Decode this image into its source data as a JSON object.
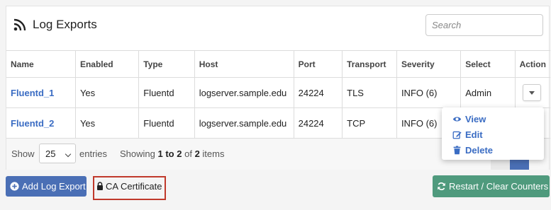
{
  "panel": {
    "title": "Log Exports",
    "search_placeholder": "Search"
  },
  "table": {
    "headers": [
      "Name",
      "Enabled",
      "Type",
      "Host",
      "Port",
      "Transport",
      "Severity",
      "Select",
      "Action"
    ],
    "rows": [
      {
        "name": "Fluentd_1",
        "enabled": "Yes",
        "type": "Fluentd",
        "host": "logserver.sample.edu",
        "port": "24224",
        "transport": "TLS",
        "severity": "INFO (6)",
        "select": "Admin"
      },
      {
        "name": "Fluentd_2",
        "enabled": "Yes",
        "type": "Fluentd",
        "host": "logserver.sample.edu",
        "port": "24224",
        "transport": "TCP",
        "severity": "INFO (6)",
        "select": ""
      }
    ]
  },
  "footer": {
    "show_label": "Show",
    "page_size": "25",
    "entries_label": "entries",
    "info_prefix": "Showing",
    "info_range": "1 to 2",
    "info_of": "of",
    "info_total": "2",
    "info_suffix": "items"
  },
  "action_menu": {
    "view": "View",
    "edit": "Edit",
    "delete": "Delete"
  },
  "buttons": {
    "add": "Add Log Export",
    "ca": "CA Certificate",
    "restart": "Restart / Clear Counters"
  },
  "colors": {
    "link": "#3a6cc3",
    "primary": "#4a6fb5",
    "success": "#4f9a7d",
    "highlight_border": "#c0392b"
  },
  "icons": {
    "title": "rss-icon",
    "view": "eye-icon",
    "edit": "edit-icon",
    "delete": "trash-icon",
    "add": "plus-circle-icon",
    "ca": "lock-icon",
    "restart": "refresh-icon",
    "action": "caret-down-icon"
  }
}
